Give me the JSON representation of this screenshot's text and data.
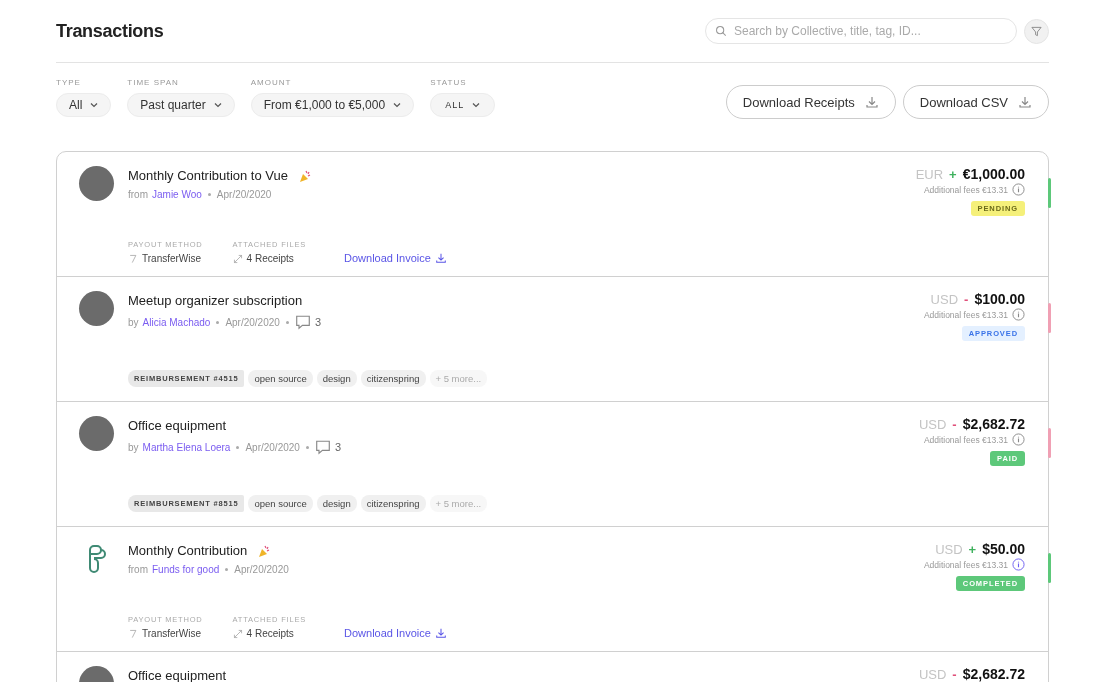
{
  "header": {
    "title": "Transactions",
    "search": {
      "placeholder": "Search by Collective, title, tag, ID..."
    }
  },
  "filters": [
    {
      "label": "TYPE",
      "value": "All",
      "kind": "normal"
    },
    {
      "label": "TIME SPAN",
      "value": "Past quarter",
      "kind": "normal"
    },
    {
      "label": "AMOUNT",
      "value": "From €1,000 to €5,000",
      "kind": "normal"
    },
    {
      "label": "STATUS",
      "value": "ALL",
      "kind": "small"
    }
  ],
  "actions": [
    "Download Receipts",
    "Download CSV"
  ],
  "transactions": [
    {
      "kind": "contribution",
      "avatar": {
        "kind": "photo"
      },
      "title": "Monthly Contribution to Vue",
      "celebration": true,
      "prefix": "from",
      "person": "Jamie Woo",
      "date": "Apr/20/2020",
      "currency": "EUR",
      "incoming": true,
      "sign": "+",
      "amount": "€1,000.00",
      "fees": "Additional fees €13.31",
      "info_highlighted": false,
      "status": "PENDING",
      "color": "#f5f07a",
      "payout_label": "PAYOUT METHOD",
      "payout": "TransferWise",
      "files_label": "ATTACHED FILES",
      "files": "4 Receipts",
      "invoice": "Download Invoice"
    },
    {
      "kind": "expense",
      "avatar": {
        "kind": "photo"
      },
      "title": "Meetup organizer subscription",
      "celebration": false,
      "prefix": "by",
      "person": "Alicia Machado",
      "date": "Apr/20/2020",
      "comments": "3",
      "currency": "USD",
      "incoming": false,
      "sign": "-",
      "amount": "$100.00",
      "fees": "Additional fees €13.31",
      "info_highlighted": false,
      "status": "APPROVED",
      "color": "#e4f0ff",
      "tags": [
        "REIMBURSEMENT #4515",
        "open source",
        "design",
        "citizenspring"
      ],
      "more": "+ 5 more..."
    },
    {
      "kind": "expense",
      "avatar": {
        "kind": "photo"
      },
      "title": "Office equipment",
      "celebration": false,
      "prefix": "by",
      "person": "Martha Elena Loera",
      "date": "Apr/20/2020",
      "comments": "3",
      "currency": "USD",
      "incoming": false,
      "sign": "-",
      "amount": "$2,682.72",
      "fees": "Additional fees €13.31",
      "info_highlighted": false,
      "status": "PAID",
      "color": "#5dc87a",
      "tags": [
        "REIMBURSEMENT #8515",
        "open source",
        "design",
        "citizenspring"
      ],
      "more": "+ 5 more..."
    },
    {
      "kind": "contribution",
      "avatar": {
        "kind": "logo"
      },
      "title": "Monthly Contribution",
      "celebration": true,
      "prefix": "from",
      "person": "Funds for good",
      "date": "Apr/20/2020",
      "currency": "USD",
      "incoming": true,
      "sign": "+",
      "amount": "$50.00",
      "fees": "Additional fees €13.31",
      "info_highlighted": true,
      "status": "COMPLETED",
      "color": "#5dc87a",
      "payout_label": "PAYOUT METHOD",
      "payout": "TransferWise",
      "files_label": "ATTACHED FILES",
      "files": "4 Receipts",
      "invoice": "Download Invoice"
    },
    {
      "kind": "partial",
      "avatar": {
        "kind": "photo"
      },
      "title": "Office equipment",
      "celebration": false,
      "currency": "USD",
      "incoming": false,
      "sign": "-",
      "amount": "$2,682.72"
    }
  ]
}
